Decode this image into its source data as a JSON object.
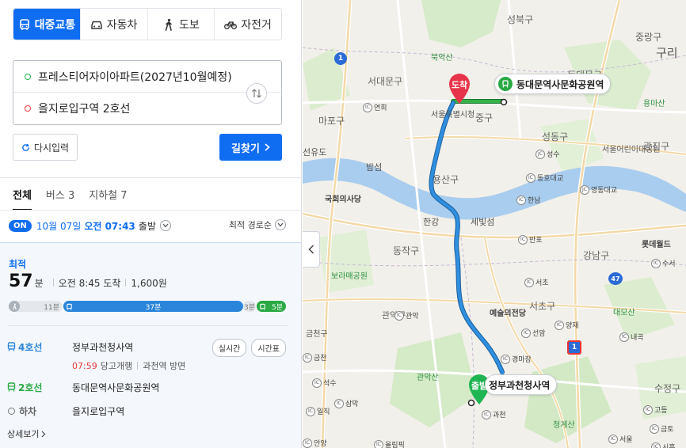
{
  "modes": [
    {
      "label": "대중교통",
      "icon": "bus-icon",
      "active": true
    },
    {
      "label": "자동차",
      "icon": "car-icon",
      "active": false
    },
    {
      "label": "도보",
      "icon": "walk-icon",
      "active": false
    },
    {
      "label": "자전거",
      "icon": "bicycle-icon",
      "active": false
    }
  ],
  "route": {
    "start": "프레스티어자이아파트(2027년10월예정)",
    "end": "을지로입구역 2호선"
  },
  "buttons": {
    "reset": "다시입력",
    "search": "길찾기"
  },
  "tabs": [
    {
      "label": "전체",
      "active": true
    },
    {
      "label": "버스 3",
      "active": false
    },
    {
      "label": "지하철 7",
      "active": false
    }
  ],
  "departure": {
    "on_badge": "ON",
    "date": "10월 07일",
    "time": "오전 07:43",
    "suffix": "출발",
    "sort": "최적 경로순"
  },
  "result": {
    "best_label": "최적",
    "minutes": "57",
    "minutes_unit": "분",
    "arrival": "오전 8:45 도착",
    "fare": "1,600원",
    "segments": {
      "walk1": "11분",
      "subway1": "37분",
      "walk2": "3분",
      "subway2": "5분"
    },
    "steps": [
      {
        "line": "4호선",
        "station": "정부과천청사역",
        "chips": [
          "실시간",
          "시간표"
        ],
        "color": "#2b86db"
      },
      {
        "line": "2호선",
        "station": "동대문역사문화공원역",
        "color": "#2aa944"
      },
      {
        "line": "하차",
        "station": "을지로입구역",
        "color": "#666666"
      }
    ],
    "realtime": {
      "time": "07:59",
      "dest": "당고개행",
      "direction": "과천역 방면"
    },
    "detail": "상세보기"
  },
  "map": {
    "labels": {
      "seongbuk": "성북구",
      "jungnang": "중랑구",
      "guri": "구리",
      "bukaksan": "북악산",
      "seodaemun": "서대문구",
      "dongdaemun": "동대문구",
      "yongmasan": "용마산",
      "mapo": "마포구",
      "jung": "중구",
      "seoul_city_hall": "서울특별시청",
      "seongdong": "성동구",
      "seoul_forest": "서울어린이대공원",
      "gwangjin": "광진구",
      "yeouido": "선유도",
      "bamseom": "밤섬",
      "yongsan": "용산구",
      "national_assembly": "국회의사당",
      "hangang": "한강",
      "sebitseom": "세빛섬",
      "dongjak": "동작구",
      "gangnam": "강남구",
      "lotte_world": "롯데월드",
      "boramae": "보라매공원",
      "seocho": "서초구",
      "arts_center": "예술의전당",
      "daemosan": "대모산",
      "gwanaksan": "관악산",
      "gwanak": "관악구",
      "geumcheon": "금천구",
      "cheonggyesan": "청계산",
      "sujeong": "수정구",
      "arrival_pin": "도착",
      "depart_pin": "출발",
      "station_dongdaemun": "동대문역사문화공원역",
      "station_gwacheon": "정부과천청사역"
    },
    "ic": [
      "연희",
      "성수",
      "동호대교",
      "영동대교",
      "한남",
      "반포",
      "서초",
      "양재",
      "선암",
      "경마장",
      "과천",
      "관악",
      "금천",
      "석수",
      "안양",
      "일직",
      "삼막",
      "내곡",
      "고등",
      "금토",
      "시흥",
      "수서",
      "서울",
      "올림픽"
    ],
    "highways": [
      "1",
      "47",
      "1"
    ]
  }
}
